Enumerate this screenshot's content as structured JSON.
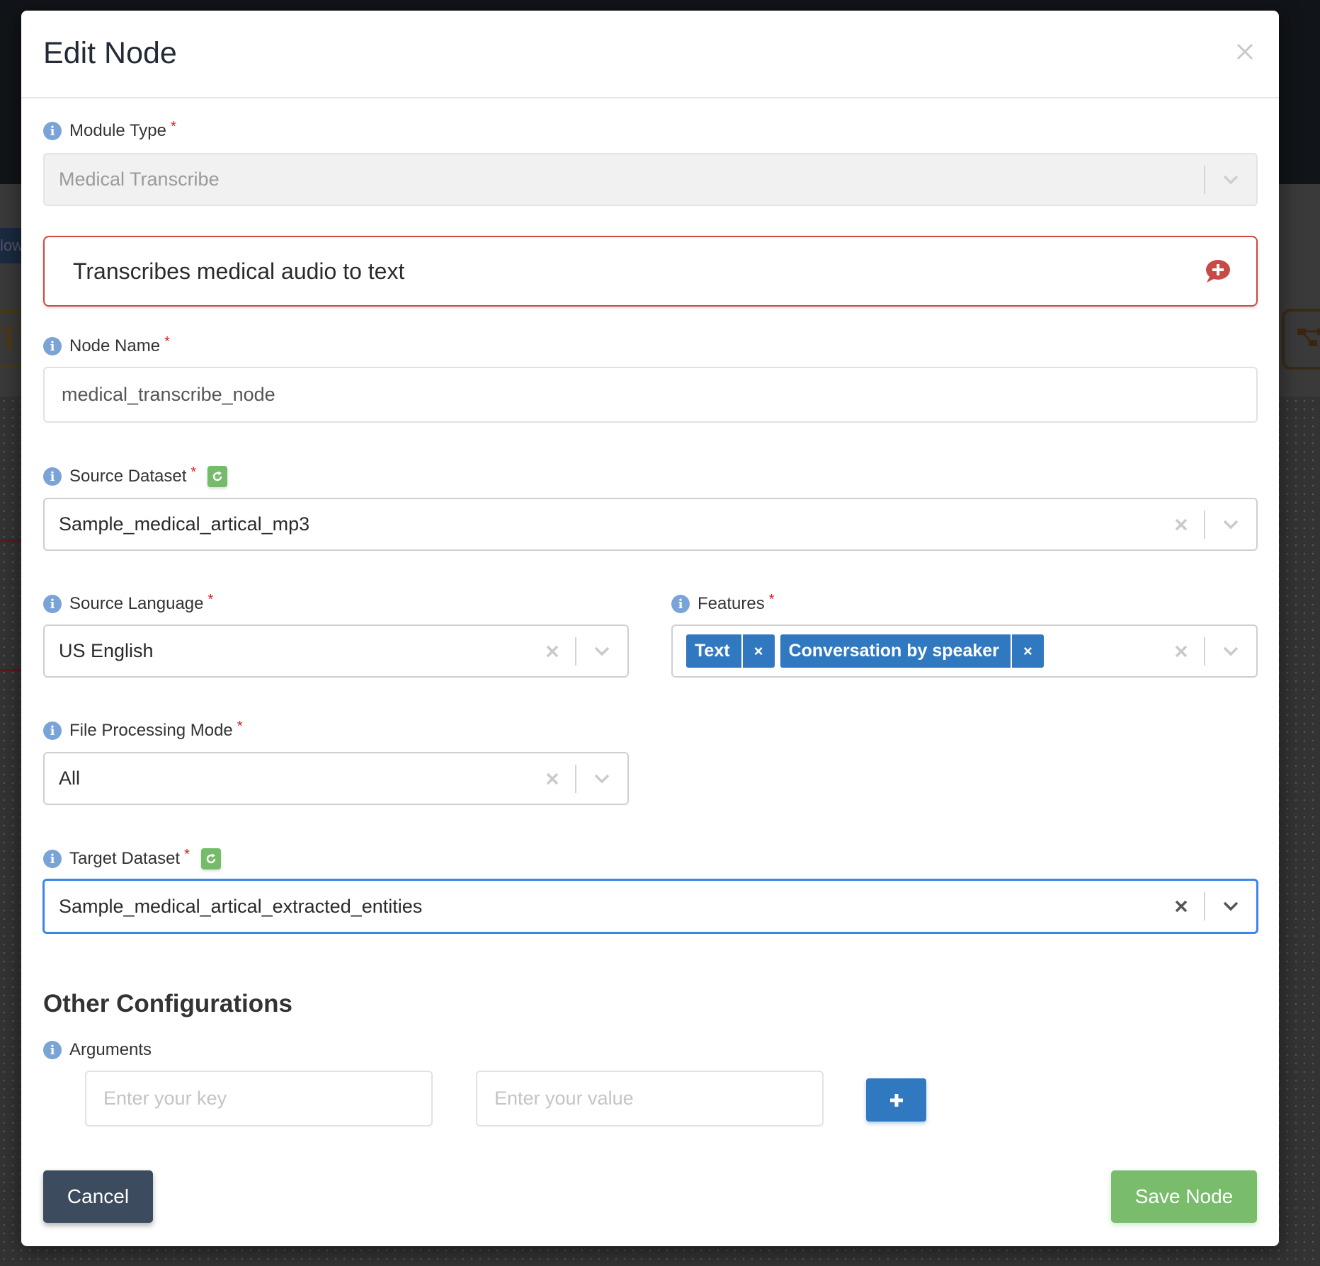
{
  "background": {
    "flow_tab_fragment": "low",
    "node_fragment": "T"
  },
  "modal": {
    "title": "Edit Node",
    "close_icon": "close-icon"
  },
  "fields": {
    "module_type": {
      "label": "Module Type",
      "required_mark": "*",
      "value": "Medical Transcribe",
      "disabled": true
    },
    "description": {
      "text": "Transcribes medical audio to text",
      "icon": "comment-plus-icon"
    },
    "node_name": {
      "label": "Node Name",
      "required_mark": "*",
      "value": "medical_transcribe_node"
    },
    "source_dataset": {
      "label": "Source Dataset",
      "required_mark": "*",
      "value": "Sample_medical_artical_mp3",
      "refresh_icon": "refresh-icon"
    },
    "source_language": {
      "label": "Source Language",
      "required_mark": "*",
      "value": "US English"
    },
    "features": {
      "label": "Features",
      "required_mark": "*",
      "tags": [
        {
          "label": "Text",
          "remove": "×"
        },
        {
          "label": "Conversation by speaker",
          "remove": "×"
        }
      ]
    },
    "file_processing_mode": {
      "label": "File Processing Mode",
      "required_mark": "*",
      "value": "All"
    },
    "target_dataset": {
      "label": "Target Dataset",
      "required_mark": "*",
      "value": "Sample_medical_artical_extracted_entities",
      "focused": true,
      "refresh_icon": "refresh-icon"
    }
  },
  "other_configurations": {
    "title": "Other Configurations",
    "arguments": {
      "label": "Arguments",
      "key_placeholder": "Enter your key",
      "key_value": "",
      "value_placeholder": "Enter your value",
      "value_value": "",
      "add_icon": "plus-icon"
    }
  },
  "footer": {
    "cancel_label": "Cancel",
    "save_label": "Save Node"
  },
  "colors": {
    "primary": "#3078c0",
    "success": "#78bc6c",
    "danger": "#c94a44",
    "focus": "#3d86e8",
    "info_icon": "#7aa3d8",
    "cancel": "#3c4b5d"
  }
}
